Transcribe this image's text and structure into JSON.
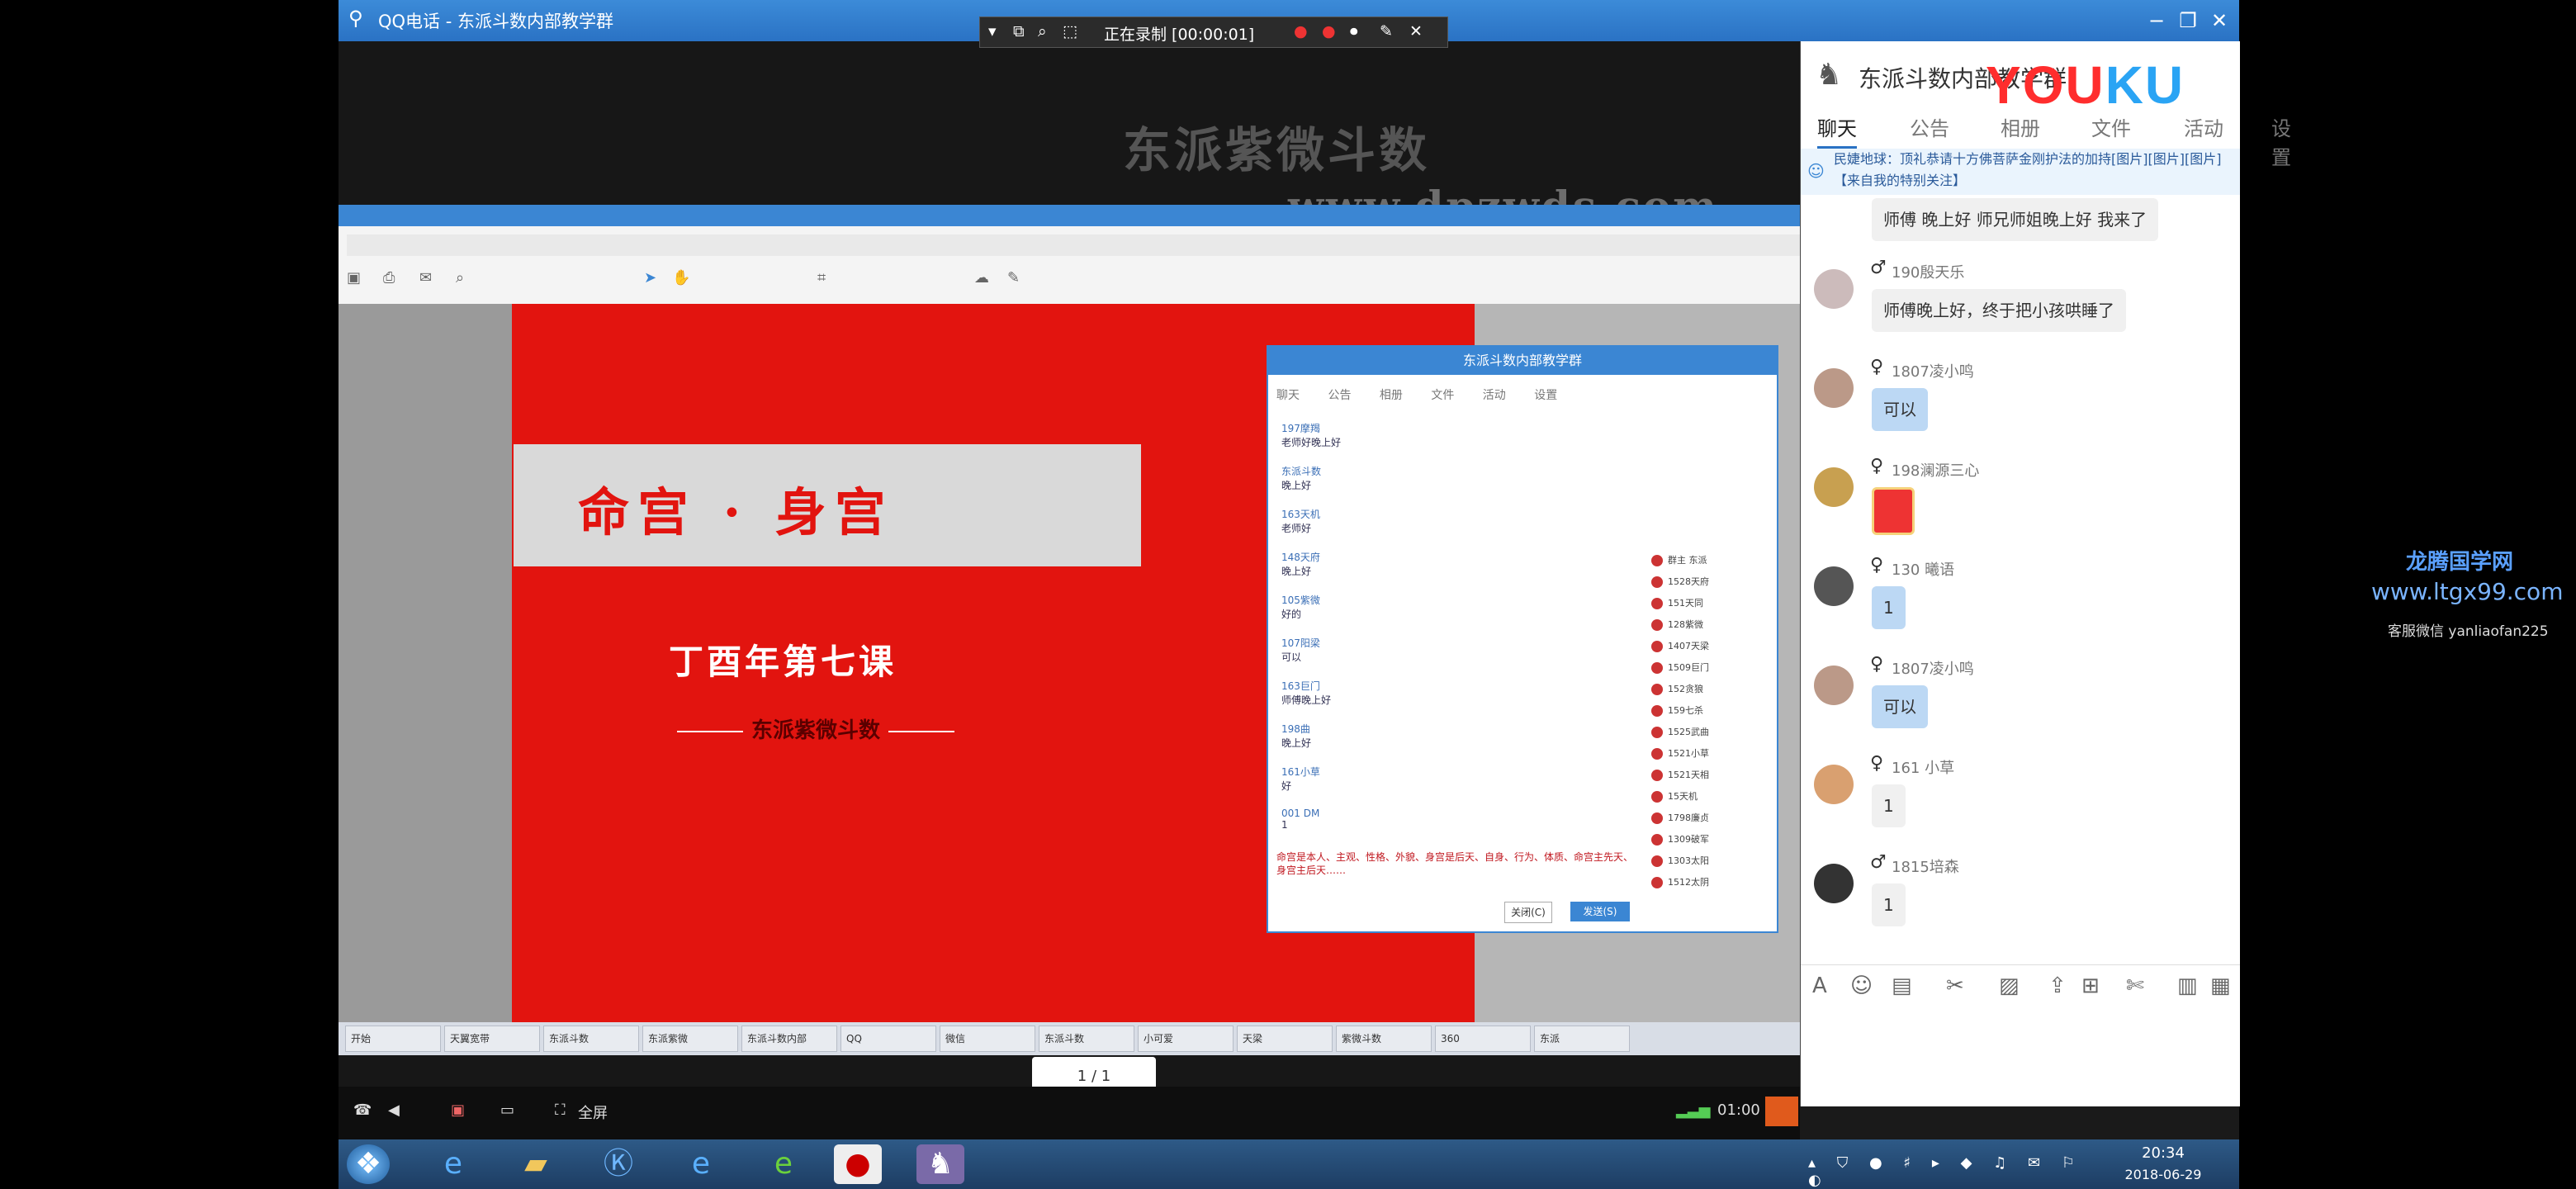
{
  "window": {
    "title": "QQ电话 - 东派斗数内部教学群",
    "recording": "正在录制 [00:00:01]"
  },
  "video": {
    "watermark_name": "东派紫微斗数",
    "watermark_url": "www.dpzwds.com",
    "page_indicator": "1 / 1",
    "controls": {
      "fullscreen": "全屏",
      "time": "01:00"
    }
  },
  "slide": {
    "title": "命宫 · 身宫",
    "subtitle": "丁酉年第七课",
    "brand": "东派紫微斗数"
  },
  "inner_chat": {
    "title": "东派斗数内部教学群",
    "tabs": "聊天 公告 相册 文件 活动 设置",
    "messages": [
      "197摩羯",
      "东派斗数",
      "163天机",
      "148天府",
      "105紫微",
      "107阳梁",
      "163巨门",
      "198曲",
      "161小草",
      "001 DM"
    ],
    "message_texts": [
      "老师好晚上好",
      "晚上好",
      "老师好",
      "晚上好",
      "好的",
      "可以",
      "师傅晚上好",
      "晚上好",
      "好",
      "1"
    ],
    "input_text": "命宫是本人、主观、性格、外貌、身宫是后天、自身、行为、体质、命宫主先天、身宫主后天……",
    "close_label": "关闭(C)",
    "send_label": "发送(S)",
    "members": [
      "群主 东派",
      "1528天府",
      "151天同",
      "128紫微",
      "1407天梁",
      "1509巨门",
      "152贪狼",
      "159七杀",
      "1525武曲",
      "1521小草",
      "1521天相",
      "15天机",
      "1798廉贞",
      "1309破军",
      "1303太阳",
      "1512太阴"
    ]
  },
  "inner_taskbar": [
    "开始",
    "天翼宽带",
    "东派斗数",
    "东派紫微",
    "东派斗数内部",
    "QQ",
    "微信",
    "东派斗数",
    "小可爱",
    "天梁",
    "紫微斗数",
    "360",
    "东派"
  ],
  "right_panel": {
    "group_name": "东派斗数内部教学群",
    "youku_a": "YOU",
    "youku_b": "KU",
    "tabs": [
      "聊天",
      "公告",
      "相册",
      "文件",
      "活动",
      "设置"
    ],
    "notice": "民婕地球：顶礼恭请十方佛菩萨金刚护法的加持[图片][图片][图片]【来自我的特别关注】",
    "messages": [
      {
        "gender": "",
        "name": "",
        "text": "师傅 晚上好  师兄师姐晚上好  我来了",
        "blue": false
      },
      {
        "gender": "♂",
        "name": "190殷天乐",
        "text": "师傅晚上好，终于把小孩哄睡了",
        "blue": false
      },
      {
        "gender": "♀",
        "name": "1807凌小鸣",
        "text": "可以",
        "blue": true
      },
      {
        "gender": "♀",
        "name": "198澜源三心",
        "text": "",
        "blue": false
      },
      {
        "gender": "♀",
        "name": "130 曦语",
        "text": "1",
        "blue": true
      },
      {
        "gender": "♀",
        "name": "1807凌小鸣",
        "text": "可以",
        "blue": true
      },
      {
        "gender": "♀",
        "name": "161 小草",
        "text": "1",
        "blue": false
      },
      {
        "gender": "♂",
        "name": "1815培森",
        "text": "1",
        "blue": false
      }
    ]
  },
  "outside_watermark": {
    "name": "龙腾国学网",
    "url": "www.ltgx99.com",
    "wechat": "客服微信 yanliaofan225"
  },
  "taskbar": {
    "time": "20:34",
    "date": "2018-06-29"
  },
  "colors": {
    "qq_blue": "#2a72c4",
    "slide_red": "#e2140f",
    "youku_red": "#ff2d2d",
    "youku_blue": "#2aa4f4"
  }
}
